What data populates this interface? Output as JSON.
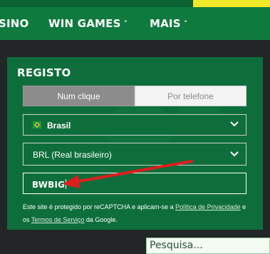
{
  "nav": {
    "items": [
      {
        "label": "SINO",
        "chevron": false
      },
      {
        "label": "WIN GAMES",
        "chevron": true
      },
      {
        "label": "MAIS",
        "chevron": true
      }
    ]
  },
  "registration": {
    "title": "REGISTO",
    "tabs": [
      "Num clique",
      "Por telefone"
    ],
    "country": "Brasil",
    "currency": "BRL (Real brasileiro)",
    "promo_code": "BWBIG",
    "legal_prefix": "Este site é protegido por reCAPTCHA e aplicam-se a ",
    "privacy_link": "Política de Privacidade",
    "legal_mid": " e os ",
    "terms_link": "Termos de Serviço",
    "legal_suffix": " da Google."
  },
  "search": {
    "placeholder": "Pesquisa..."
  },
  "colors": {
    "brand_green": "#0f7a3e",
    "panel_green": "#0e6e3b",
    "accent_yellow": "#f1e92a",
    "annotation_red": "#e01d1d"
  }
}
